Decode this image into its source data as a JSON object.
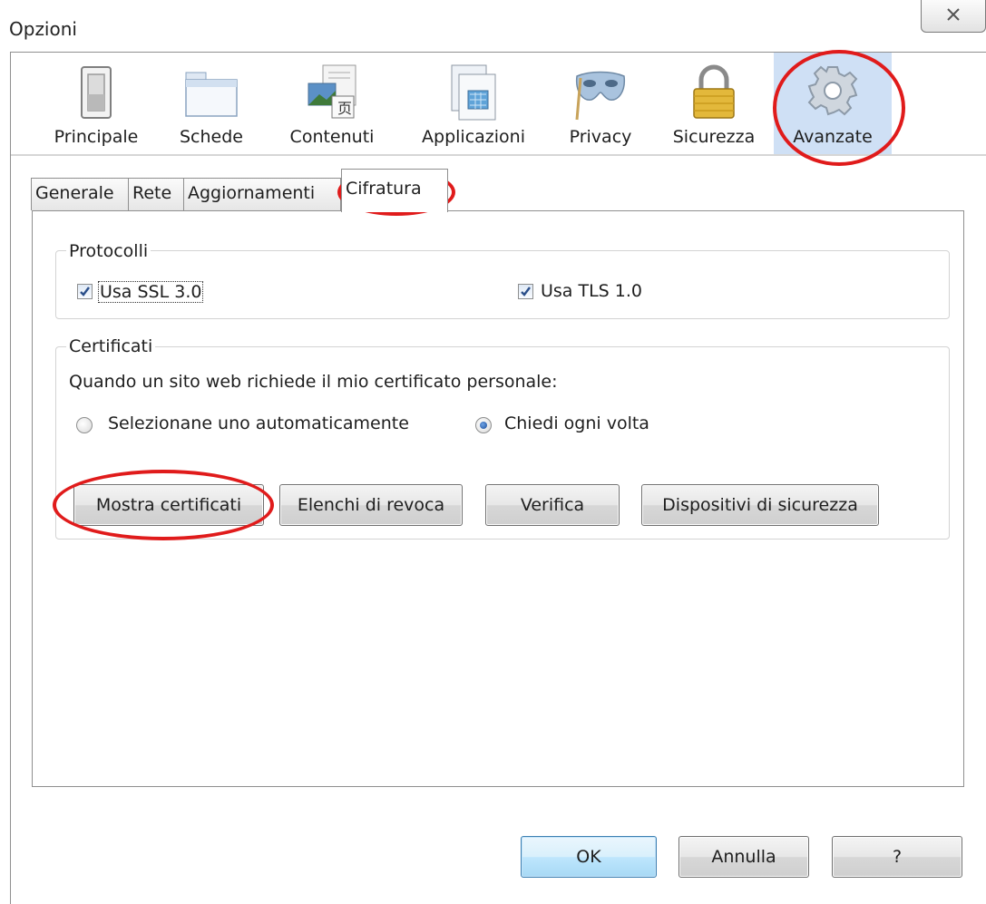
{
  "window": {
    "title": "Opzioni"
  },
  "toolbar": {
    "panes": [
      {
        "label": "Principale",
        "icon": "light-switch-icon"
      },
      {
        "label": "Schede",
        "icon": "tabs-window-icon"
      },
      {
        "label": "Contenuti",
        "icon": "content-image-icon"
      },
      {
        "label": "Applicazioni",
        "icon": "applications-window-icon"
      },
      {
        "label": "Privacy",
        "icon": "mask-icon"
      },
      {
        "label": "Sicurezza",
        "icon": "padlock-icon"
      },
      {
        "label": "Avanzate",
        "icon": "gear-icon",
        "selected": true
      }
    ]
  },
  "tabs": [
    {
      "label": "Generale"
    },
    {
      "label": "Rete"
    },
    {
      "label": "Aggiornamenti"
    },
    {
      "label": "Cifratura",
      "active": true
    }
  ],
  "protocols": {
    "legend": "Protocolli",
    "ssl": {
      "label": "Usa SSL 3.0",
      "checked": true
    },
    "tls": {
      "label": "Usa TLS 1.0",
      "checked": true
    }
  },
  "certificates": {
    "legend": "Certificati",
    "prompt": "Quando un sito web richiede il mio certificato personale:",
    "radio_auto": {
      "label": "Selezionane uno automaticamente",
      "selected": false
    },
    "radio_ask": {
      "label": "Chiedi ogni volta",
      "selected": true
    },
    "buttons": {
      "show": "Mostra certificati",
      "revocation": "Elenchi di revoca",
      "verify": "Verifica",
      "devices": "Dispositivi di sicurezza"
    }
  },
  "dialog_buttons": {
    "ok": "OK",
    "cancel": "Annulla",
    "help": "?"
  },
  "colors": {
    "highlight_ellipse": "#e01b1b",
    "selected_pane": "#cfe0f5"
  }
}
